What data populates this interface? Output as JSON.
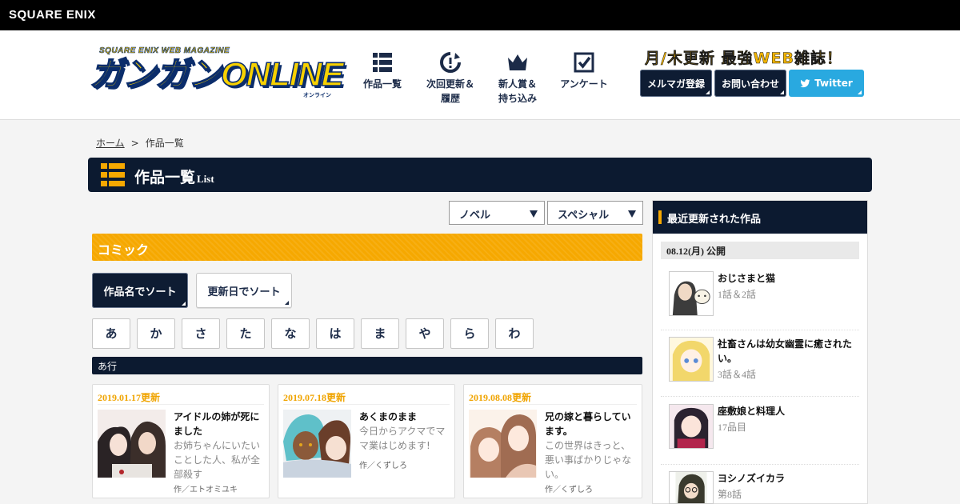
{
  "brand": "SQUARE ENIX",
  "logo": {
    "subtitle": "SQUARE ENIX WEB MAGAZINE",
    "title": "ガンガンONLINE",
    "kana": "オンライン"
  },
  "nav": [
    {
      "label": "作品一覧",
      "icon": "list-grid-icon"
    },
    {
      "label": "次回更新＆\n履歴",
      "icon": "history-clock-icon"
    },
    {
      "label": "新人賞＆\n持ち込み",
      "icon": "crown-icon"
    },
    {
      "label": "アンケート",
      "icon": "checkbox-icon"
    }
  ],
  "tagline": "月/木更新 最強WEB雑誌！",
  "header_buttons": {
    "newsletter": "メルマガ登録",
    "contact": "お問い合わせ",
    "twitter": "Twitter"
  },
  "colors": {
    "navy": "#0c1a30",
    "orange": "#f6a800",
    "twitter": "#29a9e0"
  },
  "breadcrumb": {
    "home": "ホーム",
    "separator": ">",
    "current": "作品一覧"
  },
  "page_title": {
    "main": "作品一覧",
    "sub": "List"
  },
  "dropdowns": {
    "novel": "ノベル",
    "special": "スペシャル"
  },
  "section_label": "コミック",
  "sort": {
    "by_name": "作品名でソート",
    "by_date": "更新日でソート"
  },
  "kana_filters": [
    "あ",
    "か",
    "さ",
    "た",
    "な",
    "は",
    "ま",
    "や",
    "ら",
    "わ"
  ],
  "row_label": "あ行",
  "cards": [
    {
      "date": "2019.01.17更新",
      "title": "アイドルの姉が死にました",
      "desc": "お姉ちゃんにいたいことした人、私が全部殺す",
      "author": "作／エトオミユキ"
    },
    {
      "date": "2019.07.18更新",
      "title": "あくまのまま",
      "desc": "今日からアクマでママ業はじめます!",
      "author": "作／くずしろ"
    },
    {
      "date": "2019.08.08更新",
      "title": "兄の嫁と暮らしています。",
      "desc": "この世界はきっと、悪い事ばかりじゃない。",
      "author": "作／くずしろ"
    }
  ],
  "sidebar": {
    "title": "最近更新された作品",
    "date": "08.12(月) 公開",
    "items": [
      {
        "title": "おじさまと猫",
        "sub": "1話＆2話"
      },
      {
        "title": "社畜さんは幼女幽霊に癒されたい。",
        "sub": "3話＆4話"
      },
      {
        "title": "座敷娘と料理人",
        "sub": "17品目"
      },
      {
        "title": "ヨシノズイカラ",
        "sub": "第8話"
      }
    ]
  }
}
